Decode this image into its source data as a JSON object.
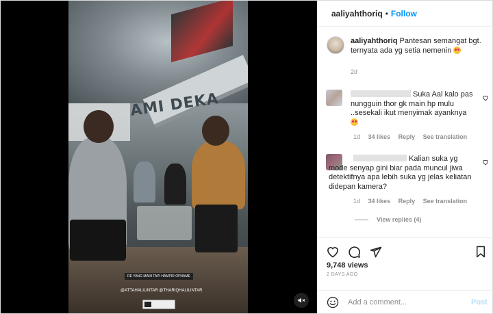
{
  "post": {
    "username": "aaliyahthoriq",
    "separator": "•",
    "follow_label": "Follow"
  },
  "video": {
    "graffiti": "AMI  DEKA",
    "overlay_caption": "RE YANG MAIN TAPI HAMPIR OPNAME",
    "overlay_mentions": "@ATTAHALILINTAR @THARIQHALILINTAR"
  },
  "caption": {
    "username": "aaliyahthoriq",
    "text": "Pantesan semangat bgt. ternyata ada yg setia nemenin",
    "time": "2d"
  },
  "comments": [
    {
      "text_line1": "Suka Aal kalo pas",
      "text_rest": "nungguin thor gk main hp mulu ..sesekali ikut menyimak ayanknya",
      "time": "1d",
      "likes": "34 likes",
      "reply_label": "Reply",
      "translate_label": "See translation"
    },
    {
      "text_line1": "Kalian suka yg mode",
      "text_rest": "senyap gini biar pada muncul jiwa detektifnya apa lebih suka yg jelas keliatan didepan kamera?",
      "time": "1d",
      "likes": "34 likes",
      "reply_label": "Reply",
      "translate_label": "See translation",
      "view_replies": "View replies (4)"
    }
  ],
  "stats": {
    "views": "9,748 views",
    "date": "2 DAYS AGO"
  },
  "composer": {
    "placeholder": "Add a comment...",
    "post_label": "Post"
  },
  "icons": [
    "volume-off-icon",
    "heart-icon",
    "comment-icon",
    "share-icon",
    "bookmark-icon",
    "emoji-icon"
  ]
}
